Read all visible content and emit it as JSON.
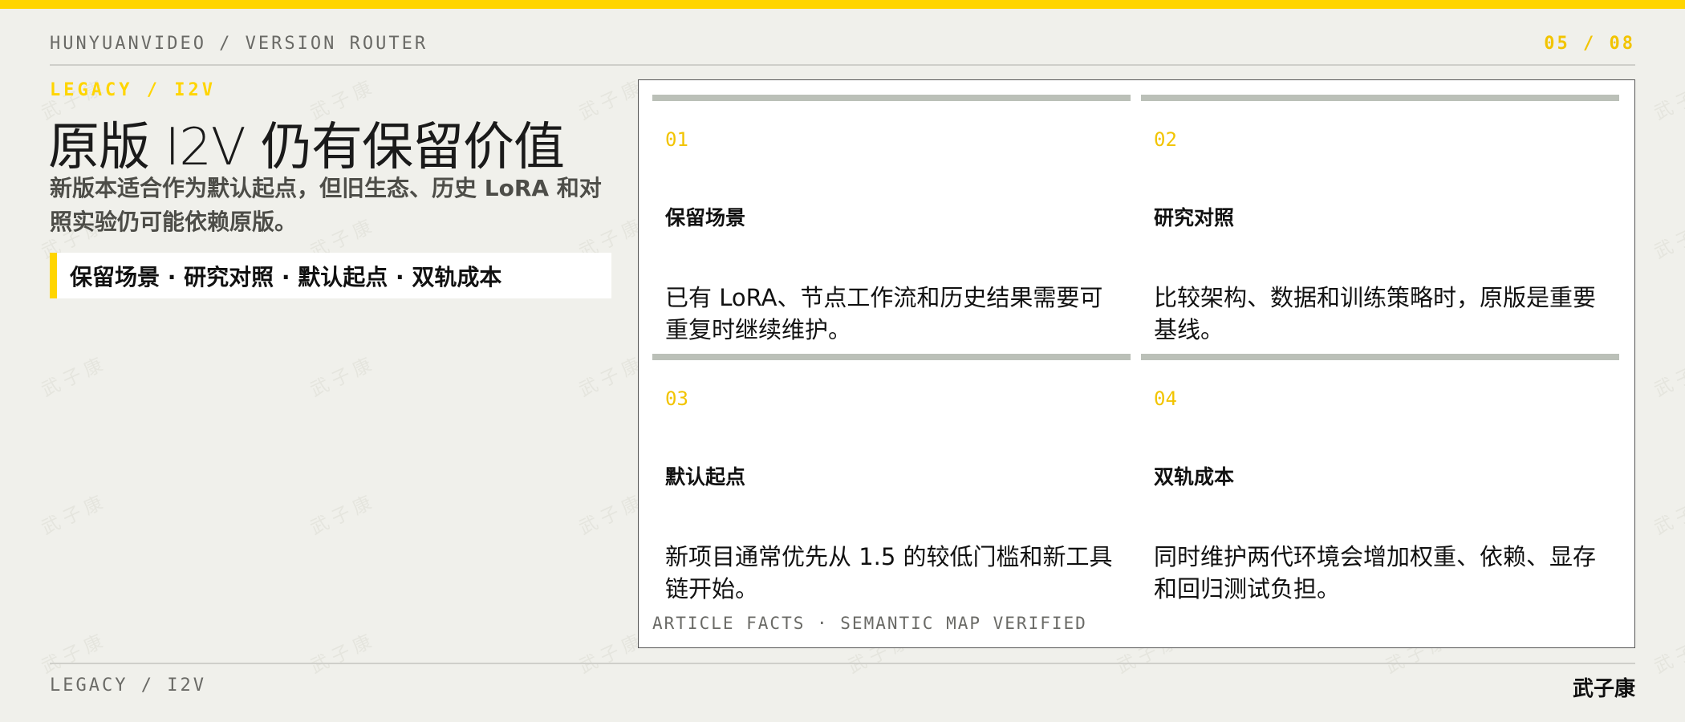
{
  "header": {
    "breadcrumb": "HUNYUANVIDEO / VERSION ROUTER",
    "page_counter": "05 / 08"
  },
  "slide": {
    "section_label": "LEGACY / I2V",
    "headline": "原版 I2V 仍有保留价值",
    "subtitle": "新版本适合作为默认起点，但旧生态、历史 LoRA 和对照实验仍可能依赖原版。",
    "keyword_bar": "保留场景 · 研究对照 · 默认起点 · 双轨成本"
  },
  "cards": [
    {
      "number": "01",
      "title": "保留场景",
      "description": "已有 LoRA、节点工作流和历史结果需要可重复时继续维护。"
    },
    {
      "number": "02",
      "title": "研究对照",
      "description": "比较架构、数据和训练策略时，原版是重要基线。"
    },
    {
      "number": "03",
      "title": "默认起点",
      "description": "新项目通常优先从 1.5 的较低门槛和新工具链开始。"
    },
    {
      "number": "04",
      "title": "双轨成本",
      "description": "同时维护两代环境会增加权重、依赖、显存和回归测试负担。"
    }
  ],
  "panel_footer": "ARTICLE FACTS · SEMANTIC MAP VERIFIED",
  "footer": {
    "label": "LEGACY / I2V",
    "author": "武子康"
  },
  "watermark_text": "武子康",
  "colors": {
    "accent": "#ffd500",
    "background": "#f0f0eb",
    "card_bar": "#bbc0b8",
    "panel": "#ffffff"
  }
}
